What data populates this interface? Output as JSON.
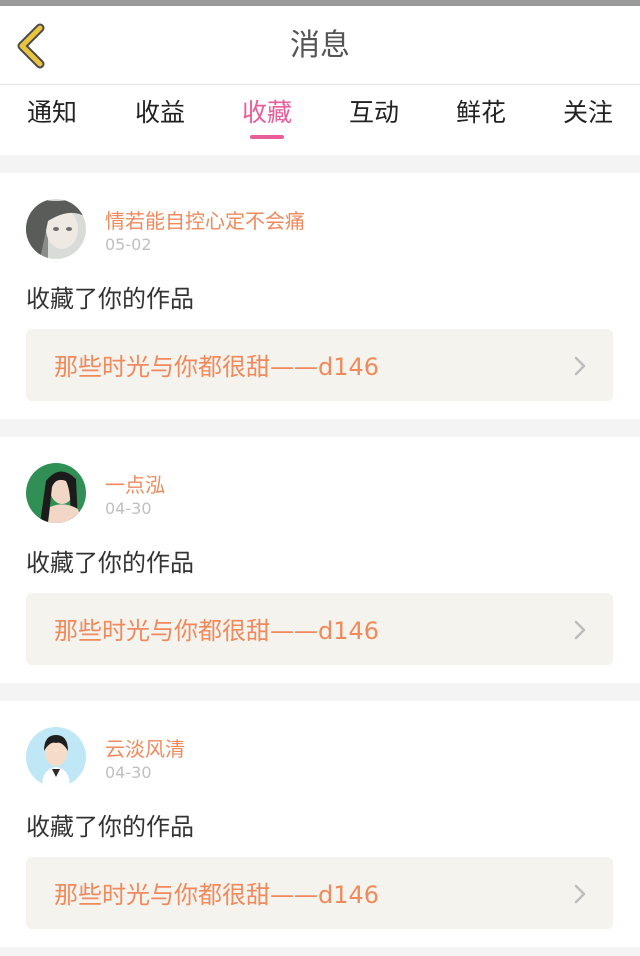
{
  "header": {
    "title": "消息"
  },
  "tabs": [
    {
      "label": "通知",
      "active": false
    },
    {
      "label": "收益",
      "active": false
    },
    {
      "label": "收藏",
      "active": true
    },
    {
      "label": "互动",
      "active": false
    },
    {
      "label": "鲜花",
      "active": false
    },
    {
      "label": "关注",
      "active": false
    }
  ],
  "messages": [
    {
      "user": "情若能自控心定不会痛",
      "date": "05-02",
      "action": "收藏了你的作品",
      "work": "那些时光与你都很甜——d146"
    },
    {
      "user": "一点泓",
      "date": "04-30",
      "action": "收藏了你的作品",
      "work": "那些时光与你都很甜——d146"
    },
    {
      "user": "云淡风清",
      "date": "04-30",
      "action": "收藏了你的作品",
      "work": "那些时光与你都很甜——d146"
    }
  ],
  "colors": {
    "accent": "#e95d9b",
    "username": "#f08a5d",
    "back_icon": "#e9c43f"
  }
}
